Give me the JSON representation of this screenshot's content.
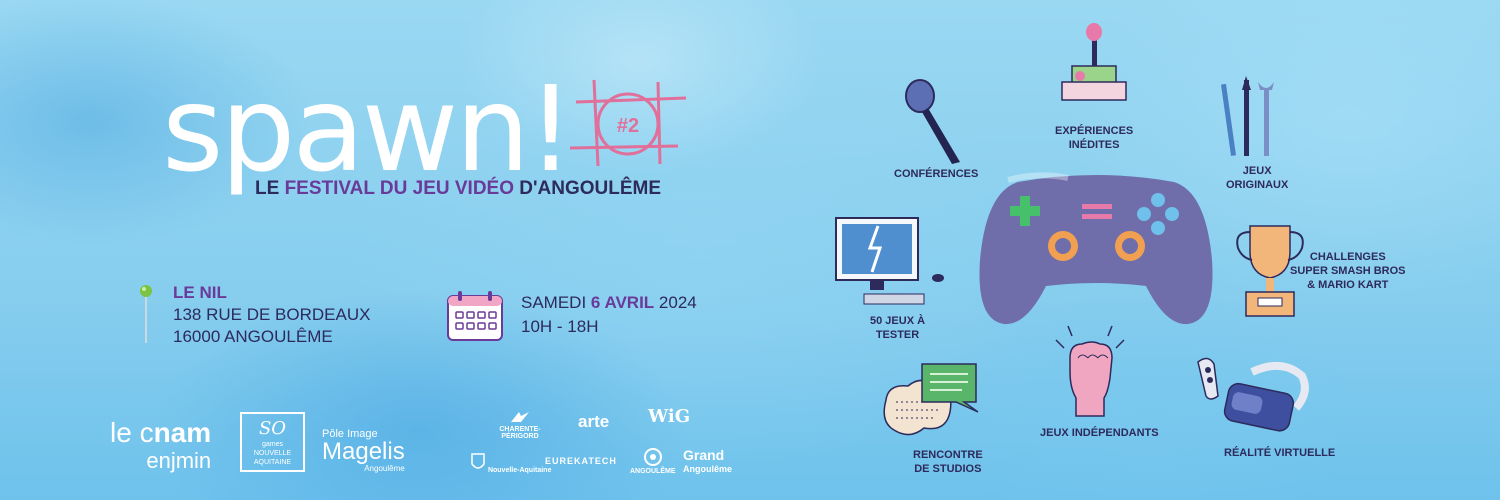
{
  "logo": {
    "word": "spawn!",
    "edition": "#2"
  },
  "tagline": {
    "prefix": "LE ",
    "highlight": "FESTIVAL DU JEU VIDÉO",
    "suffix": " D'ANGOULÊME"
  },
  "venue": {
    "name": "LE NIL",
    "street": "138 RUE DE BORDEAUX",
    "city": "16000 ANGOULÊME"
  },
  "event_date": {
    "prefix": "SAMEDI ",
    "day": "6 AVRIL",
    "year": " 2024",
    "hours": "10H - 18H"
  },
  "partners": {
    "cnam": {
      "le": "le c",
      "nam": "nam",
      "sub": "enjmin"
    },
    "so_games": {
      "line1": "SO",
      "line2": "games",
      "line3": "NOUVELLE",
      "line4": "AQUITAINE"
    },
    "magelis": {
      "line1": "Pôle Image",
      "line2": "Magelis",
      "line3": "Angoulême"
    },
    "credit_agricole": "CHARENTE-PÉRIGORD",
    "arte": "arte",
    "wig": "WiG",
    "nouvelle_aquitaine": "Nouvelle-Aquitaine",
    "eurekatech": "EUREKATECH",
    "angouleme": "ANGOULÊME",
    "grand_angouleme": {
      "line1": "Grand",
      "line2": "Angoulême"
    }
  },
  "activities": {
    "conferences": "CONFÉRENCES",
    "experiences": [
      "EXPÉRIENCES",
      "INÉDITES"
    ],
    "jeux_originaux": [
      "JEUX",
      "ORIGINAUX"
    ],
    "challenges": [
      "CHALLENGES",
      "SUPER SMASH BROS",
      "& MARIO KART"
    ],
    "cinquante_jeux": [
      "50 JEUX À",
      "TESTER"
    ],
    "rencontre": [
      "RENCONTRE",
      "DE STUDIOS"
    ],
    "jeux_independants": "JEUX INDÉPENDANTS",
    "realite_virtuelle": "RÉALITÉ VIRTUELLE"
  },
  "colors": {
    "background": "#8fd2ef",
    "text_dark": "#2d2a5c",
    "accent_purple": "#6a3a99",
    "target_pink": "#e0709a",
    "controller": "#6f6eaa"
  }
}
